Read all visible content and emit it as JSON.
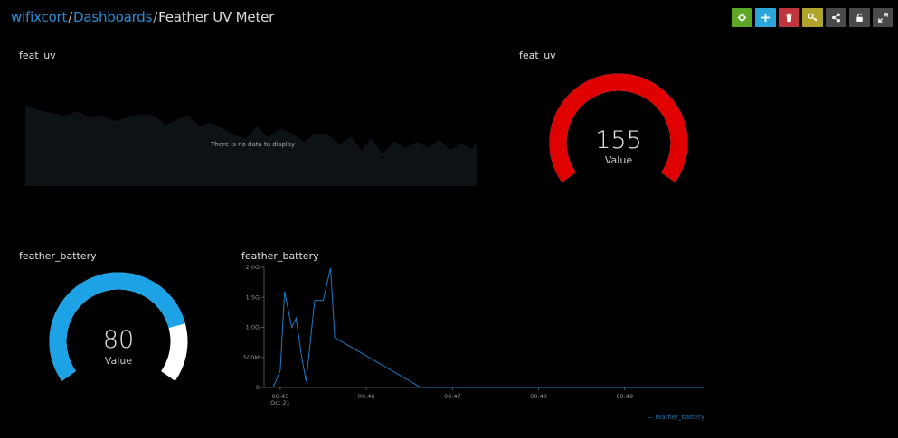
{
  "breadcrumb": {
    "user": "wifixcort",
    "section": "Dashboards",
    "current": "Feather UV Meter",
    "separator": "/"
  },
  "toolbar": {
    "buttons": [
      {
        "name": "settings-button",
        "icon": "gear-icon",
        "color": "#5ea626"
      },
      {
        "name": "add-block-button",
        "icon": "plus-icon",
        "color": "#2aa6d8"
      },
      {
        "name": "delete-button",
        "icon": "trash-icon",
        "color": "#c0353b"
      },
      {
        "name": "key-button",
        "icon": "key-icon",
        "color": "#b0a52a"
      },
      {
        "name": "share-button",
        "icon": "share-icon",
        "color": "#4a4a4a"
      },
      {
        "name": "lock-button",
        "icon": "lock-icon",
        "color": "#4a4a4a"
      },
      {
        "name": "fullscreen-button",
        "icon": "expand-icon",
        "color": "#4a4a4a"
      }
    ]
  },
  "widgets": {
    "uv_chart": {
      "title": "feat_uv",
      "no_data": "There is no data to display"
    },
    "uv_gauge": {
      "title": "feat_uv",
      "value": "155",
      "unit": "Value",
      "fill_fraction": 1.0,
      "color": "#e00000",
      "track_color": "#ffffff"
    },
    "battery_gauge": {
      "title": "feather_battery",
      "value": "80",
      "unit": "Value",
      "fill_fraction": 0.8,
      "color": "#1ea2e6",
      "track_color": "#ffffff"
    },
    "battery_chart": {
      "title": "feather_battery",
      "legend": "— feather_battery"
    }
  },
  "chart_data": {
    "type": "line",
    "title": "feather_battery",
    "y_ticks": [
      "2.0G",
      "1.5G",
      "1.0G",
      "500M",
      "0"
    ],
    "ylim": [
      0,
      2000000000
    ],
    "x_ticks": [
      "00:45",
      "00:46",
      "00:47",
      "00:48",
      "00:49"
    ],
    "x_subtick": "Oct 21",
    "series": [
      {
        "name": "feather_battery",
        "color": "#1f7bc4",
        "x": [
          "00:44:55",
          "00:45:00",
          "00:45:03",
          "00:45:08",
          "00:45:11",
          "00:45:15",
          "00:45:18",
          "00:45:24",
          "00:45:27",
          "00:45:30",
          "00:45:35",
          "00:45:38",
          "00:46:38",
          "00:47:00",
          "00:48:00",
          "00:49:00",
          "00:49:55"
        ],
        "values": [
          0,
          280000000,
          1600000000,
          1000000000,
          1150000000,
          500000000,
          100000000,
          1450000000,
          1450000000,
          1450000000,
          1990000000,
          830000000,
          0,
          0,
          0,
          0,
          0
        ]
      }
    ]
  }
}
